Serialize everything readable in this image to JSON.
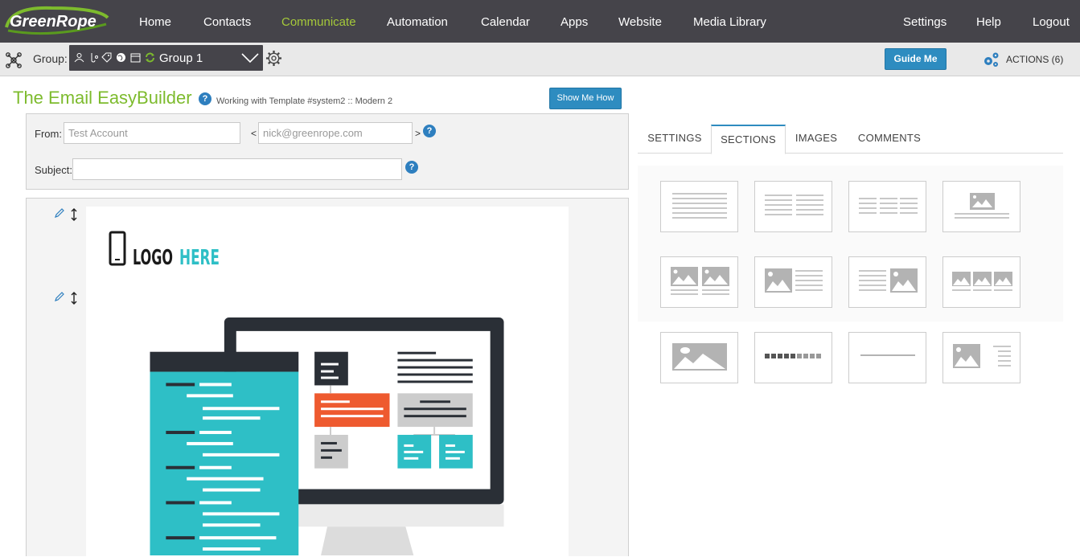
{
  "brand": {
    "name": "GreenRope",
    "accent": "#a5c93a",
    "title_color": "#7dbb2d",
    "button_color": "#2e8cc0",
    "nav_bg": "#45444a"
  },
  "nav": {
    "left": [
      "Home",
      "Contacts",
      "Communicate",
      "Automation",
      "Calendar",
      "Apps",
      "Website",
      "Media Library"
    ],
    "right": [
      "Settings",
      "Help",
      "Logout"
    ],
    "active": "Communicate"
  },
  "groupbar": {
    "label": "Group:",
    "selected_group": "Group 1",
    "guide_me": "Guide Me",
    "actions": "ACTIONS (6)"
  },
  "page": {
    "title": "The Email EasyBuilder",
    "help": "?",
    "template_info": "Working with Template #system2 :: Modern 2",
    "show_me_how": "Show Me How"
  },
  "form": {
    "from_label": "From:",
    "from_name_placeholder": "Test Account",
    "open_bracket": "<",
    "from_email_placeholder": "nick@greenrope.com",
    "close_bracket": ">",
    "subject_label": "Subject:",
    "subject_value": ""
  },
  "email": {
    "logo_text_dark": "LOGO",
    "logo_text_accent": "HERE"
  },
  "panel": {
    "tabs": [
      "SETTINGS",
      "SECTIONS",
      "IMAGES",
      "COMMENTS"
    ],
    "active_tab": "SECTIONS",
    "section_tiles": [
      "text-one-column",
      "text-two-columns",
      "text-three-columns",
      "image-above-text",
      "two-images-with-text",
      "image-left-text-right",
      "text-left-image-right",
      "three-images-with-text",
      "single-image",
      "social-icons-bar",
      "divider-line",
      "image-with-sidebar-text"
    ]
  }
}
